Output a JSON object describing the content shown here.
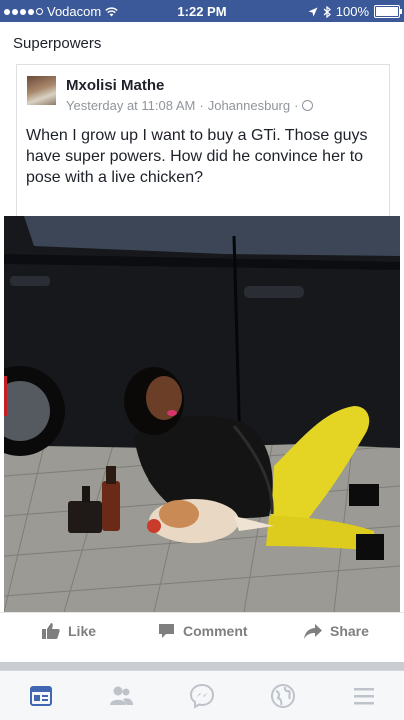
{
  "status_bar": {
    "carrier": "Vodacom",
    "time": "1:22 PM",
    "battery": "100%",
    "battery_level": 1.0
  },
  "share_header": "Superpowers",
  "post": {
    "author": "Mxolisi Mathe",
    "timestamp": "Yesterday at 11:08 AM",
    "separator": "·",
    "location": "Johannesburg",
    "text": "When I grow up I want to buy a GTi. Those guys have super powers. How did he convince her to pose with a live chicken?"
  },
  "actions": {
    "like": "Like",
    "comment": "Comment",
    "share": "Share"
  },
  "tabs": [
    "news-feed-icon",
    "friends-icon",
    "messenger-icon",
    "notifications-globe-icon",
    "menu-icon"
  ],
  "colors": {
    "brand": "#3b5998",
    "active_tab": "#4267b2",
    "inactive_tab": "#bec3c9",
    "action_text": "#7f7f7f"
  }
}
